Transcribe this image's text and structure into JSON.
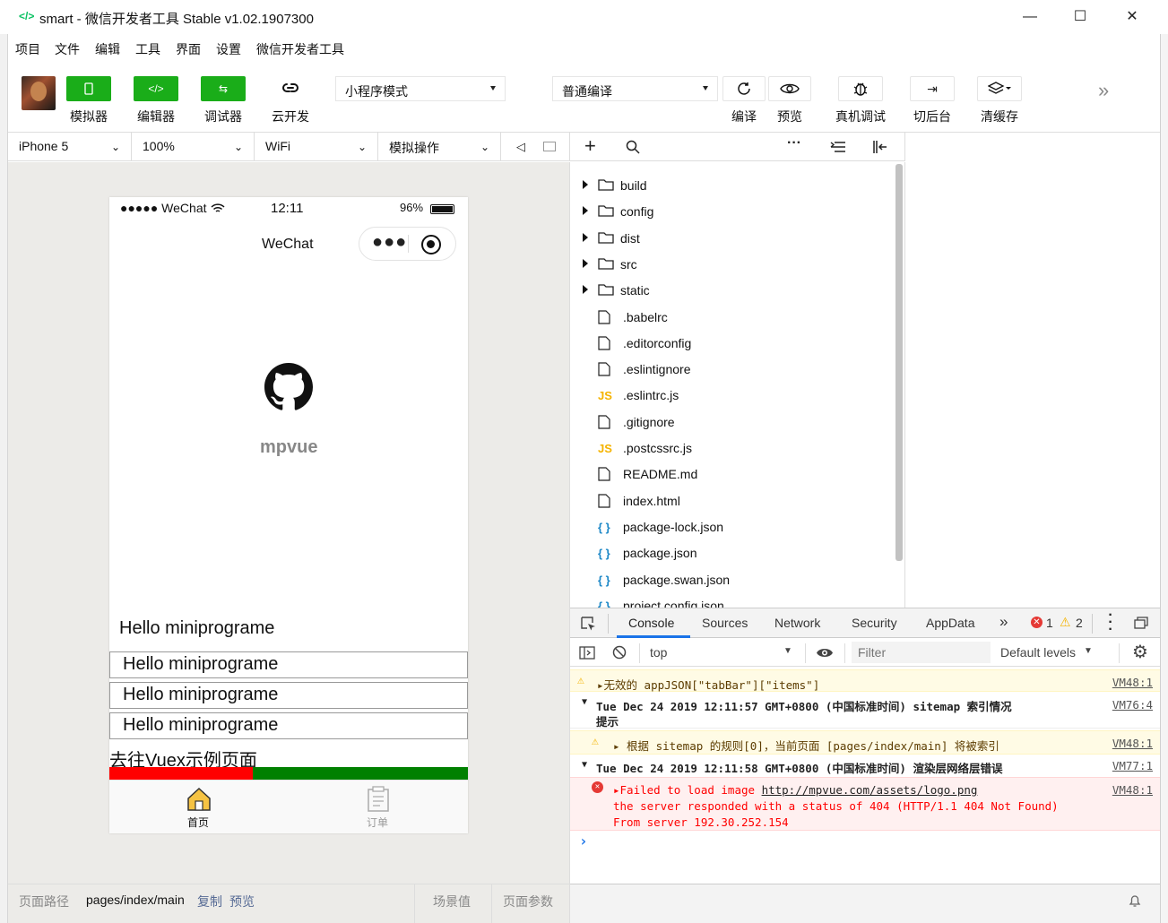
{
  "window": {
    "title": "smart - 微信开发者工具 Stable v1.02.1907300",
    "minimize": "—",
    "maximize": "☐",
    "close": "✕"
  },
  "menu": [
    "项目",
    "文件",
    "编辑",
    "工具",
    "界面",
    "设置",
    "微信开发者工具"
  ],
  "toolbar": {
    "simulator": "模拟器",
    "editor": "编辑器",
    "debugger": "调试器",
    "cloud": "云开发",
    "mode": "小程序模式",
    "compile_mode": "普通编译",
    "compile": "编译",
    "preview": "预览",
    "remote_debug": "真机调试",
    "background": "切后台",
    "clear_cache": "清缓存"
  },
  "sim_status": {
    "device": "iPhone 5",
    "zoom": "100%",
    "network": "WiFi",
    "operation": "模拟操作"
  },
  "phone": {
    "signal": "●●●●● WeChat",
    "time": "12:11",
    "battery": "96%",
    "nav_title": "WeChat",
    "logo_text": "mpvue",
    "hello_plain": "Hello miniprograme",
    "hello_boxes": [
      "Hello miniprograme",
      "Hello miniprograme",
      "Hello miniprograme"
    ],
    "vuex_link": "去往Vuex示例页面",
    "tab_home": "首页",
    "tab_orders": "订单"
  },
  "bottom_bar": {
    "path_label": "页面路径",
    "path": "pages/index/main",
    "copy": "复制",
    "preview": "预览",
    "scene": "场景值",
    "params": "页面参数"
  },
  "files": [
    {
      "name": "build",
      "type": "folder"
    },
    {
      "name": "config",
      "type": "folder"
    },
    {
      "name": "dist",
      "type": "folder"
    },
    {
      "name": "src",
      "type": "folder"
    },
    {
      "name": "static",
      "type": "folder"
    },
    {
      "name": ".babelrc",
      "type": "file"
    },
    {
      "name": ".editorconfig",
      "type": "file"
    },
    {
      "name": ".eslintignore",
      "type": "file"
    },
    {
      "name": ".eslintrc.js",
      "type": "js"
    },
    {
      "name": ".gitignore",
      "type": "file"
    },
    {
      "name": ".postcssrc.js",
      "type": "js"
    },
    {
      "name": "README.md",
      "type": "file"
    },
    {
      "name": "index.html",
      "type": "file"
    },
    {
      "name": "package-lock.json",
      "type": "json"
    },
    {
      "name": "package.json",
      "type": "json"
    },
    {
      "name": "package.swan.json",
      "type": "json"
    },
    {
      "name": "project.config.json",
      "type": "json"
    }
  ],
  "devtools": {
    "tabs": [
      "Console",
      "Sources",
      "Network",
      "Security",
      "AppData"
    ],
    "error_count": "1",
    "warning_count": "2",
    "context": "top",
    "filter_placeholder": "Filter",
    "levels": "Default levels"
  },
  "console": {
    "warn1_text": "▸无效的 appJSON[\"tabBar\"][\"items\"]",
    "warn1_src": "VM48:1",
    "group1_line1": "Tue Dec 24 2019 12:11:57 GMT+0800 (中国标准时间) sitemap 索引情况",
    "group1_line2": "提示",
    "group1_src": "VM76:4",
    "warn2_text": "▸ 根据 sitemap 的规则[0]，当前页面 [pages/index/main] 将被索引",
    "warn2_src": "VM48:1",
    "group2_text": "Tue Dec 24 2019 12:11:58 GMT+0800 (中国标准时间) 渲染层网络层错误",
    "group2_src": "VM77:1",
    "err_prefix": "▸Failed to load image ",
    "err_url": "http://mpvue.com/assets/logo.png",
    "err_line2": "the server responded with a status of 404 (HTTP/1.1 404 Not Found)",
    "err_line3": "From server 192.30.252.154",
    "err_src": "VM48:1",
    "prompt": "›"
  },
  "colors": {
    "accent_green": "#1aad19",
    "bar_red": "#ff0000",
    "bar_green": "#008000",
    "link_blue": "#576b95"
  }
}
